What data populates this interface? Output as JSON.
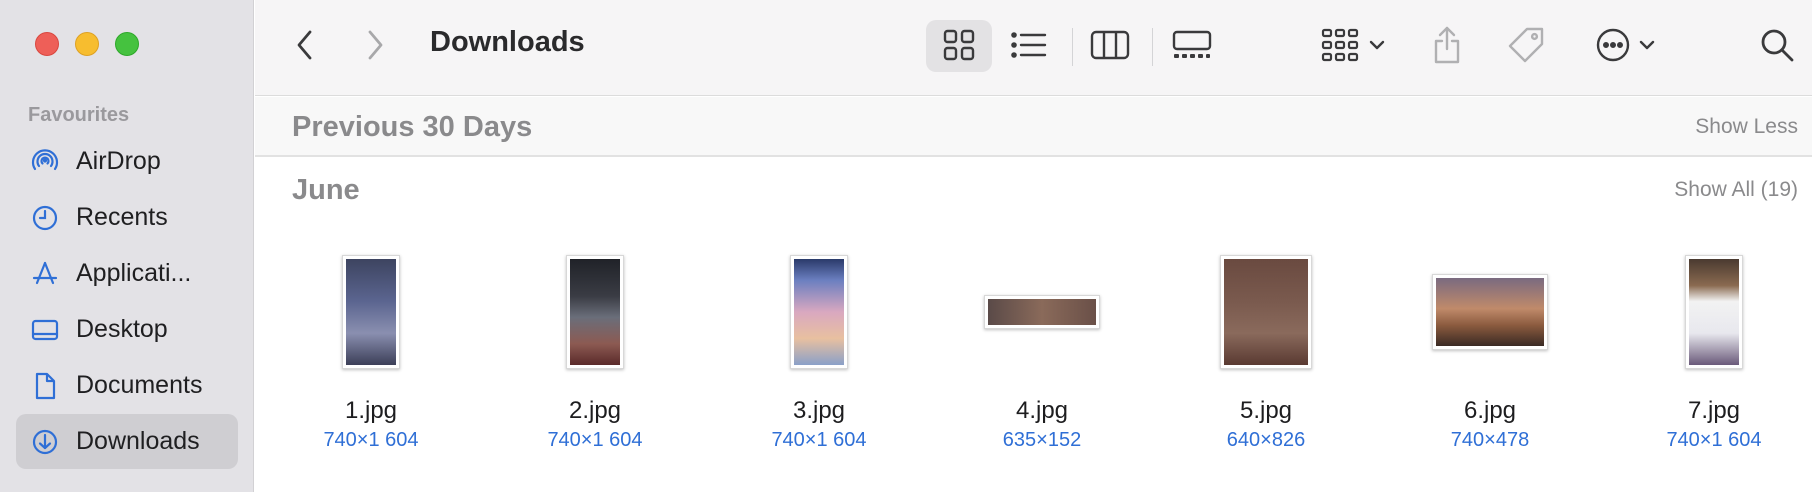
{
  "sidebar": {
    "section_heading": "Favourites",
    "items": [
      {
        "label": "AirDrop",
        "icon": "airdrop-icon",
        "active": false
      },
      {
        "label": "Recents",
        "icon": "clock-icon",
        "active": false
      },
      {
        "label": "Applicati...",
        "icon": "applications-icon",
        "active": false
      },
      {
        "label": "Desktop",
        "icon": "desktop-icon",
        "active": false
      },
      {
        "label": "Documents",
        "icon": "document-icon",
        "active": false
      },
      {
        "label": "Downloads",
        "icon": "downloads-icon",
        "active": true
      }
    ]
  },
  "toolbar": {
    "title": "Downloads",
    "icons": [
      "back-icon",
      "forward-icon",
      "grid-view-icon",
      "list-view-icon",
      "column-view-icon",
      "gallery-view-icon",
      "group-icon",
      "share-icon",
      "tag-icon",
      "more-icon",
      "search-icon"
    ]
  },
  "content": {
    "section_title": "Previous 30 Days",
    "section_action": "Show Less",
    "group_title": "June",
    "group_action": "Show All (19)",
    "files": [
      {
        "name": "1.jpg",
        "dims": "740×1 604"
      },
      {
        "name": "2.jpg",
        "dims": "740×1 604"
      },
      {
        "name": "3.jpg",
        "dims": "740×1 604"
      },
      {
        "name": "4.jpg",
        "dims": "635×152"
      },
      {
        "name": "5.jpg",
        "dims": "640×826"
      },
      {
        "name": "6.jpg",
        "dims": "740×478"
      },
      {
        "name": "7.jpg",
        "dims": "740×1 604"
      }
    ]
  },
  "colors": {
    "accent": "#2f6fd6",
    "sidebar_bg": "#e3e2e6",
    "close": "#ee5f58",
    "minimize": "#f7bd2f",
    "maximize": "#45c23f"
  }
}
